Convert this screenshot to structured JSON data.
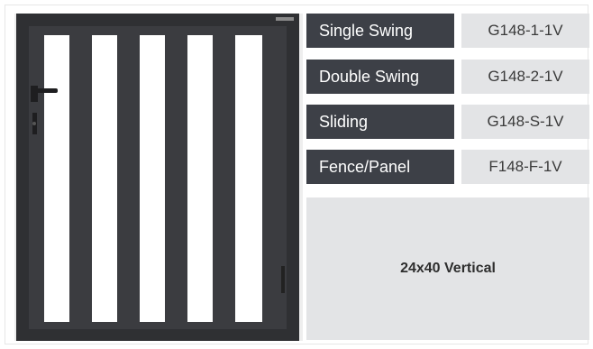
{
  "product_image": {
    "description_icon": "aluminum-vertical-bar-gate"
  },
  "models": [
    {
      "name": "Single Swing",
      "code": "G148-1-1V"
    },
    {
      "name": "Double Swing",
      "code": "G148-2-1V"
    },
    {
      "name": "Sliding",
      "code": "G148-S-1V"
    },
    {
      "name": "Fence/Panel",
      "code": "F148-F-1V"
    }
  ],
  "size_label": "24x40 Vertical",
  "colors": {
    "dark_label_bg": "#3d4047",
    "light_cell_bg": "#e3e4e6",
    "gate_frame": "#2f3033"
  }
}
